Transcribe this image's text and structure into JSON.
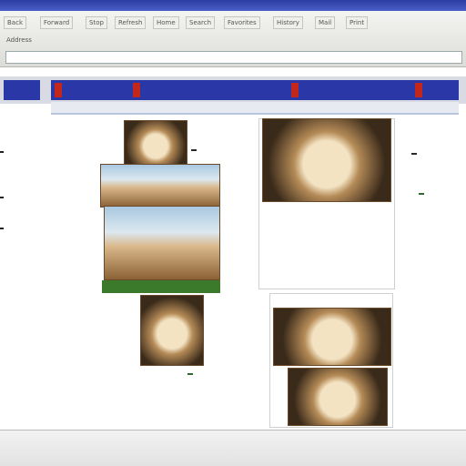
{
  "window": {
    "title": ""
  },
  "toolbar": {
    "buttons": [
      "Back",
      "Forward",
      "Stop",
      "Refresh",
      "Home",
      "Search",
      "Favorites",
      "History",
      "Mail",
      "Print"
    ],
    "address_label": "Address",
    "address_value": ""
  },
  "nav": {
    "tabs": [
      "",
      "",
      "",
      ""
    ]
  },
  "left": {
    "links": [
      "",
      "",
      "",
      ""
    ]
  },
  "content": {
    "captions": [
      "",
      "",
      "",
      ""
    ],
    "tags": [
      "",
      "",
      "",
      ""
    ]
  },
  "footer": {
    "text": ""
  },
  "colors": {
    "nav_bg": "#2a37a6",
    "tab_bg": "#c3271c",
    "title_bg": "#2c3ea3"
  }
}
